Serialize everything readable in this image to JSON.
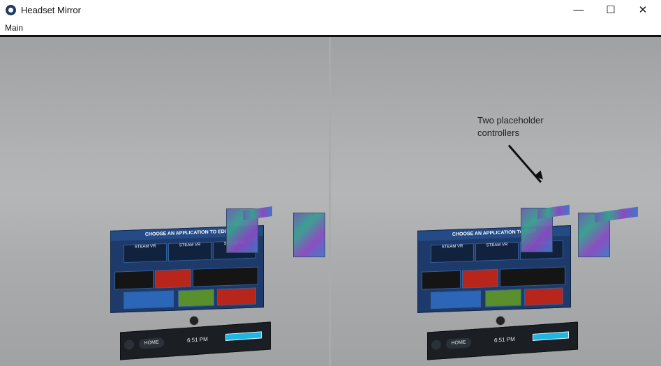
{
  "window": {
    "title": "Headset Mirror",
    "minimize_glyph": "—",
    "maximize_glyph": "☐",
    "close_glyph": "✕"
  },
  "menu": {
    "items": [
      "Main"
    ]
  },
  "annotation": {
    "text": "Two placeholder\ncontrollers"
  },
  "vr": {
    "panel_title": "CHOOSE AN APPLICATION TO EDIT",
    "tiles": [
      "STEAM VR",
      "STEAM VR",
      "STEAM VR"
    ],
    "dock_time": "6:51 PM",
    "dock_home": "HOME"
  }
}
